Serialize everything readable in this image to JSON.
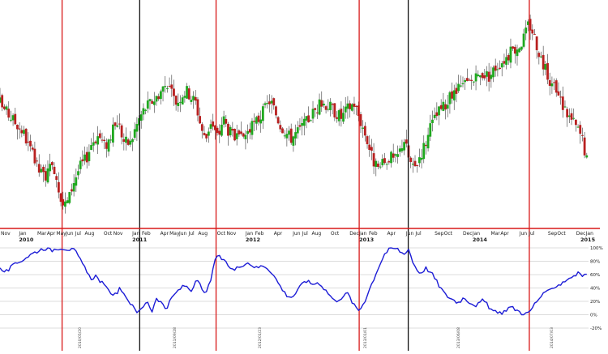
{
  "chart_data": [
    {
      "type": "candlestick",
      "panel": "price",
      "x_range": [
        "2009-11-01",
        "2015-01-15"
      ],
      "y_axis_labels": "none",
      "grid": false,
      "candle_colors": {
        "up": "#1fa81f",
        "down": "#b82020",
        "wick": "#555555"
      },
      "month_labels": [
        "Nov",
        "Jan",
        "Mar",
        "Apr",
        "May",
        "Jun",
        "Jul",
        "Aug",
        "Oct",
        "Nov",
        "Jan",
        "Feb",
        "Apr",
        "May",
        "Jun",
        "Jul",
        "Aug",
        "Oct",
        "Nov",
        "Jan",
        "Feb",
        "Apr",
        "Jun",
        "Jul",
        "Aug",
        "Oct",
        "Dec",
        "Jan",
        "Feb",
        "Apr",
        "Jun",
        "Jul",
        "Sep",
        "Oct",
        "Dec",
        "Jan",
        "Mar",
        "Apr",
        "Jun",
        "Jul",
        "Sep",
        "Oct",
        "Dec",
        "Jan"
      ],
      "year_labels": [
        "2010",
        "2011",
        "2012",
        "2013",
        "2014",
        "2015"
      ],
      "price_path": [
        [
          "2009-11-01",
          82
        ],
        [
          "2009-11-20",
          76
        ],
        [
          "2009-12-15",
          70
        ],
        [
          "2010-01-15",
          62
        ],
        [
          "2010-02-10",
          48
        ],
        [
          "2010-03-05",
          36
        ],
        [
          "2010-03-25",
          32
        ],
        [
          "2010-04-10",
          36
        ],
        [
          "2010-04-25",
          38
        ],
        [
          "2010-05-12",
          22
        ],
        [
          "2010-05-25",
          12
        ],
        [
          "2010-06-10",
          16
        ],
        [
          "2010-06-25",
          28
        ],
        [
          "2010-07-15",
          38
        ],
        [
          "2010-08-05",
          44
        ],
        [
          "2010-08-25",
          56
        ],
        [
          "2010-09-15",
          60
        ],
        [
          "2010-10-05",
          52
        ],
        [
          "2010-10-25",
          60
        ],
        [
          "2010-11-15",
          70
        ],
        [
          "2010-12-05",
          56
        ],
        [
          "2010-12-25",
          54
        ],
        [
          "2011-01-10",
          64
        ],
        [
          "2011-01-25",
          72
        ],
        [
          "2011-02-10",
          78
        ],
        [
          "2011-03-01",
          82
        ],
        [
          "2011-03-20",
          86
        ],
        [
          "2011-04-10",
          92
        ],
        [
          "2011-04-25",
          96
        ],
        [
          "2011-05-10",
          86
        ],
        [
          "2011-05-25",
          82
        ],
        [
          "2011-06-10",
          88
        ],
        [
          "2011-06-25",
          90
        ],
        [
          "2011-07-10",
          86
        ],
        [
          "2011-07-25",
          82
        ],
        [
          "2011-08-10",
          66
        ],
        [
          "2011-08-25",
          56
        ],
        [
          "2011-09-10",
          70
        ],
        [
          "2011-09-25",
          62
        ],
        [
          "2011-10-05",
          58
        ],
        [
          "2011-10-20",
          72
        ],
        [
          "2011-11-05",
          64
        ],
        [
          "2011-11-25",
          58
        ],
        [
          "2011-12-15",
          56
        ],
        [
          "2012-01-05",
          62
        ],
        [
          "2012-01-25",
          66
        ],
        [
          "2012-02-15",
          72
        ],
        [
          "2012-03-05",
          78
        ],
        [
          "2012-03-20",
          84
        ],
        [
          "2012-04-05",
          76
        ],
        [
          "2012-04-20",
          68
        ],
        [
          "2012-05-10",
          62
        ],
        [
          "2012-05-25",
          58
        ],
        [
          "2012-06-15",
          62
        ],
        [
          "2012-07-05",
          66
        ],
        [
          "2012-07-25",
          72
        ],
        [
          "2012-08-15",
          78
        ],
        [
          "2012-09-05",
          82
        ],
        [
          "2012-09-25",
          80
        ],
        [
          "2012-10-15",
          76
        ],
        [
          "2012-11-05",
          72
        ],
        [
          "2012-11-25",
          78
        ],
        [
          "2012-12-15",
          82
        ],
        [
          "2013-01-05",
          70
        ],
        [
          "2013-01-25",
          58
        ],
        [
          "2013-02-10",
          46
        ],
        [
          "2013-02-28",
          36
        ],
        [
          "2013-03-20",
          40
        ],
        [
          "2013-04-10",
          46
        ],
        [
          "2013-04-25",
          42
        ],
        [
          "2013-05-10",
          48
        ],
        [
          "2013-05-25",
          58
        ],
        [
          "2013-06-10",
          44
        ],
        [
          "2013-06-25",
          36
        ],
        [
          "2013-07-15",
          46
        ],
        [
          "2013-08-05",
          56
        ],
        [
          "2013-08-25",
          68
        ],
        [
          "2013-09-15",
          76
        ],
        [
          "2013-10-05",
          80
        ],
        [
          "2013-10-25",
          86
        ],
        [
          "2013-11-15",
          90
        ],
        [
          "2013-12-05",
          94
        ],
        [
          "2013-12-25",
          96
        ],
        [
          "2014-01-15",
          98
        ],
        [
          "2014-02-05",
          102
        ],
        [
          "2014-02-25",
          100
        ],
        [
          "2014-03-15",
          106
        ],
        [
          "2014-04-05",
          110
        ],
        [
          "2014-04-25",
          114
        ],
        [
          "2014-05-15",
          118
        ],
        [
          "2014-06-05",
          122
        ],
        [
          "2014-06-20",
          128
        ],
        [
          "2014-07-01",
          136
        ],
        [
          "2014-07-15",
          130
        ],
        [
          "2014-08-01",
          118
        ],
        [
          "2014-08-20",
          106
        ],
        [
          "2014-09-10",
          96
        ],
        [
          "2014-09-30",
          88
        ],
        [
          "2014-10-20",
          80
        ],
        [
          "2014-11-10",
          72
        ],
        [
          "2014-11-30",
          66
        ],
        [
          "2014-12-20",
          58
        ],
        [
          "2015-01-05",
          42
        ]
      ],
      "vertical_markers": [
        {
          "date": "2010-05-20",
          "color": "#d81818"
        },
        {
          "date": "2011-01-25",
          "color": "#111111"
        },
        {
          "date": "2011-09-28",
          "color": "#d81818"
        },
        {
          "date": "2013-01-01",
          "color": "#d81818"
        },
        {
          "date": "2013-06-08",
          "color": "#111111"
        },
        {
          "date": "2014-07-03",
          "color": "#d81818"
        }
      ]
    },
    {
      "type": "line",
      "panel": "oscillator",
      "ylim": [
        -20,
        100
      ],
      "y_ticks": [
        "100%",
        "80%",
        "60%",
        "40%",
        "20%",
        "0%",
        "-20%"
      ],
      "grid": true,
      "line_color": "#1c1cd6",
      "values_path": [
        [
          "2009-11-01",
          68
        ],
        [
          "2009-11-20",
          64
        ],
        [
          "2009-12-10",
          72
        ],
        [
          "2010-01-05",
          80
        ],
        [
          "2010-01-25",
          86
        ],
        [
          "2010-02-15",
          92
        ],
        [
          "2010-03-05",
          96
        ],
        [
          "2010-03-25",
          100
        ],
        [
          "2010-04-15",
          96
        ],
        [
          "2010-05-05",
          100
        ],
        [
          "2010-05-20",
          100
        ],
        [
          "2010-06-10",
          98
        ],
        [
          "2010-06-30",
          96
        ],
        [
          "2010-07-20",
          80
        ],
        [
          "2010-08-05",
          66
        ],
        [
          "2010-08-20",
          54
        ],
        [
          "2010-09-05",
          58
        ],
        [
          "2010-09-25",
          48
        ],
        [
          "2010-10-15",
          36
        ],
        [
          "2010-11-05",
          30
        ],
        [
          "2010-11-25",
          40
        ],
        [
          "2010-12-10",
          24
        ],
        [
          "2011-01-05",
          14
        ],
        [
          "2011-01-20",
          2
        ],
        [
          "2011-02-05",
          12
        ],
        [
          "2011-02-20",
          20
        ],
        [
          "2011-03-05",
          4
        ],
        [
          "2011-03-20",
          26
        ],
        [
          "2011-04-05",
          18
        ],
        [
          "2011-04-20",
          8
        ],
        [
          "2011-05-10",
          26
        ],
        [
          "2011-06-01",
          38
        ],
        [
          "2011-06-20",
          44
        ],
        [
          "2011-07-10",
          36
        ],
        [
          "2011-07-25",
          52
        ],
        [
          "2011-08-10",
          42
        ],
        [
          "2011-08-25",
          28
        ],
        [
          "2011-09-15",
          60
        ],
        [
          "2011-09-30",
          90
        ],
        [
          "2011-10-15",
          84
        ],
        [
          "2011-11-05",
          74
        ],
        [
          "2011-11-25",
          66
        ],
        [
          "2011-12-15",
          74
        ],
        [
          "2012-01-10",
          78
        ],
        [
          "2012-02-05",
          70
        ],
        [
          "2012-03-01",
          74
        ],
        [
          "2012-03-25",
          64
        ],
        [
          "2012-04-20",
          44
        ],
        [
          "2012-05-10",
          30
        ],
        [
          "2012-05-30",
          26
        ],
        [
          "2012-06-20",
          38
        ],
        [
          "2012-07-10",
          52
        ],
        [
          "2012-08-01",
          46
        ],
        [
          "2012-08-25",
          48
        ],
        [
          "2012-09-20",
          34
        ],
        [
          "2012-10-15",
          20
        ],
        [
          "2012-11-05",
          26
        ],
        [
          "2012-11-25",
          32
        ],
        [
          "2012-12-15",
          14
        ],
        [
          "2013-01-01",
          6
        ],
        [
          "2013-01-20",
          22
        ],
        [
          "2013-02-10",
          46
        ],
        [
          "2013-03-05",
          72
        ],
        [
          "2013-03-25",
          92
        ],
        [
          "2013-04-15",
          100
        ],
        [
          "2013-05-05",
          98
        ],
        [
          "2013-05-25",
          90
        ],
        [
          "2013-06-08",
          100
        ],
        [
          "2013-06-25",
          76
        ],
        [
          "2013-07-15",
          62
        ],
        [
          "2013-08-05",
          70
        ],
        [
          "2013-08-25",
          60
        ],
        [
          "2013-09-15",
          44
        ],
        [
          "2013-10-05",
          30
        ],
        [
          "2013-10-25",
          24
        ],
        [
          "2013-11-15",
          18
        ],
        [
          "2013-12-05",
          26
        ],
        [
          "2013-12-25",
          18
        ],
        [
          "2014-01-15",
          14
        ],
        [
          "2014-02-05",
          22
        ],
        [
          "2014-02-25",
          10
        ],
        [
          "2014-03-20",
          2
        ],
        [
          "2014-04-10",
          4
        ],
        [
          "2014-05-01",
          12
        ],
        [
          "2014-05-20",
          8
        ],
        [
          "2014-06-10",
          2
        ],
        [
          "2014-07-01",
          2
        ],
        [
          "2014-07-20",
          16
        ],
        [
          "2014-08-10",
          28
        ],
        [
          "2014-09-01",
          34
        ],
        [
          "2014-09-20",
          42
        ],
        [
          "2014-10-10",
          46
        ],
        [
          "2014-10-30",
          52
        ],
        [
          "2014-11-20",
          58
        ],
        [
          "2014-12-10",
          62
        ],
        [
          "2014-12-25",
          58
        ],
        [
          "2015-01-10",
          64
        ]
      ],
      "marker_date_labels": [
        "2010/05/20",
        "2011/09/28",
        "2012/01/23",
        "2013/01/01",
        "2013/06/08",
        "2014/07/03"
      ]
    }
  ]
}
